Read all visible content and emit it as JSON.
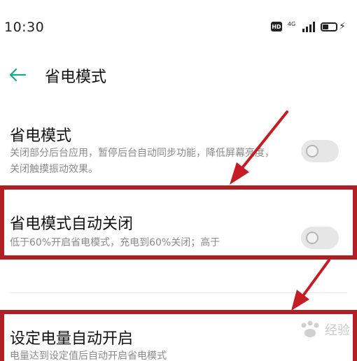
{
  "status_bar": {
    "time": "10:30",
    "hd_badge": "HD",
    "network": "4G",
    "icons": [
      "hd-icon",
      "signal-icon",
      "battery-icon",
      "charging-icon"
    ]
  },
  "header": {
    "title": "省电模式",
    "back_icon": "back-arrow-icon"
  },
  "settings": [
    {
      "title": "省电模式",
      "description": "关闭部分后台应用，暂停后台自动同步功能，降低屏幕亮度，关闭触摸振动效果。",
      "enabled": false
    },
    {
      "title": "省电模式自动关闭",
      "description": "低于60%开启省电模式，充电到60%关闭；高于",
      "enabled": false
    },
    {
      "title": "设定电量自动开启",
      "description": "电量达到设定值后自动开启省电模式",
      "enabled": false
    }
  ],
  "annotations": {
    "highlight_color": "#b11f24"
  },
  "watermark": {
    "text": "经验"
  },
  "colors": {
    "accent": "#1aa88a",
    "annotation": "#c41e24",
    "text_primary": "#111111",
    "text_secondary": "#8a8a8a"
  }
}
